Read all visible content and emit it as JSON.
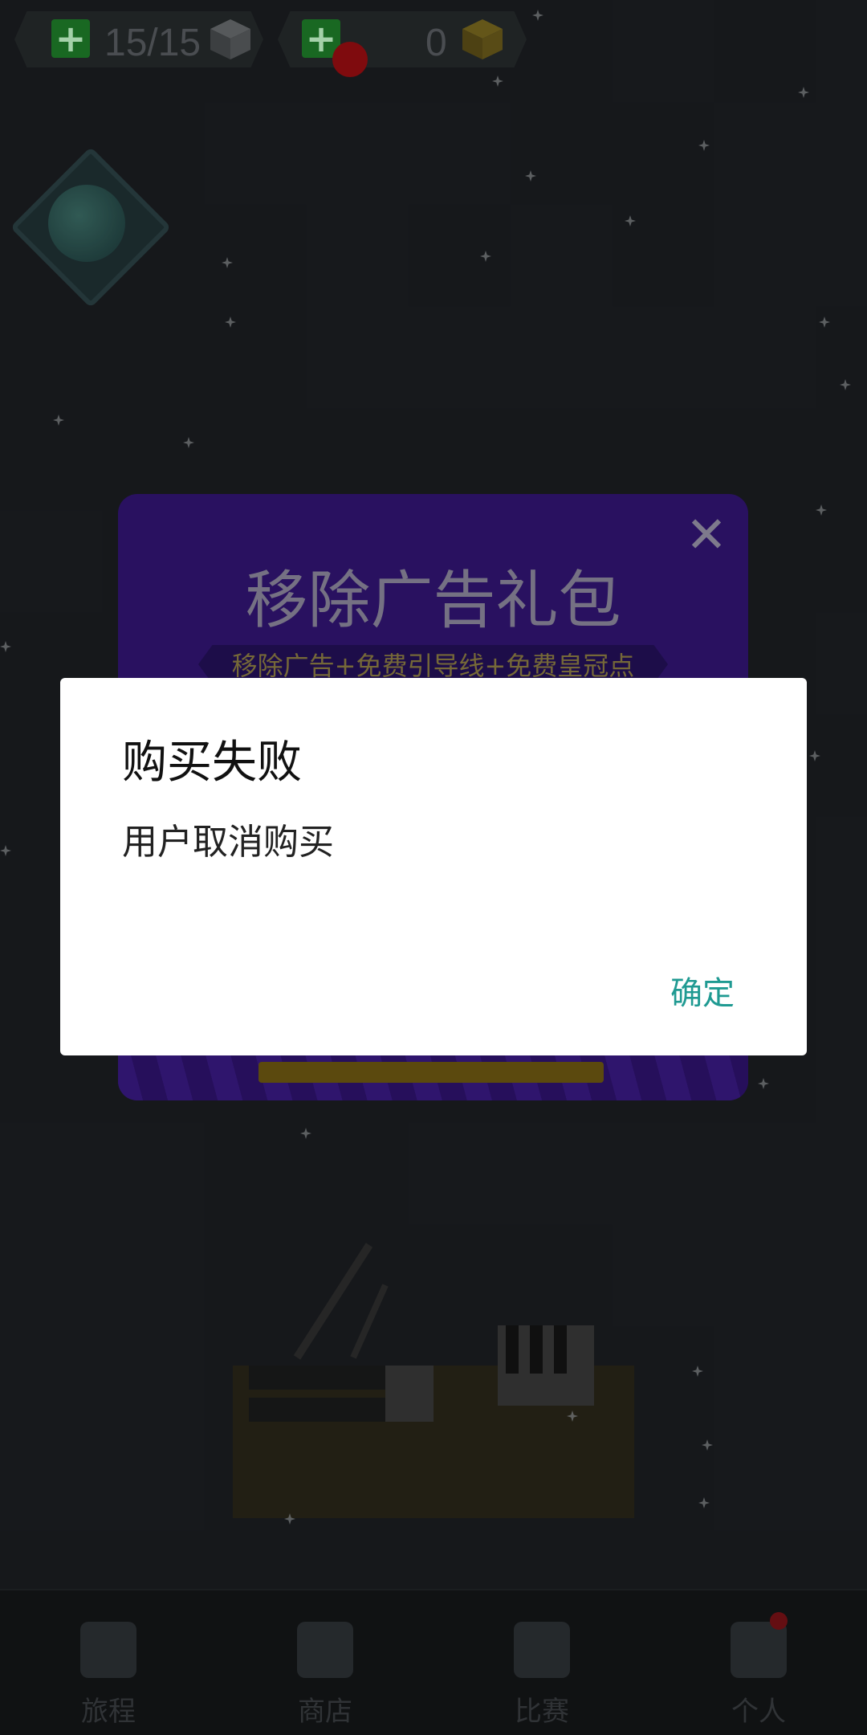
{
  "hud": {
    "lives_text": "15/15",
    "coins_text": "0"
  },
  "promo": {
    "title": "移除广告礼包",
    "subtitle": "移除广告+免费引导线+免费皇冠点",
    "close_icon": "close-icon"
  },
  "dialog": {
    "title": "购买失败",
    "message": "用户取消购买",
    "confirm_label": "确定"
  },
  "bottom_nav": {
    "items": [
      {
        "label": "旅程",
        "icon": "house-icon"
      },
      {
        "label": "商店",
        "icon": "shop-icon"
      },
      {
        "label": "比赛",
        "icon": "trophy-icon"
      },
      {
        "label": "个人",
        "icon": "person-icon"
      }
    ]
  },
  "colors": {
    "dialog_background": "#ffffff",
    "confirm_accent": "#1f9a92",
    "promo_background": "#321576"
  }
}
